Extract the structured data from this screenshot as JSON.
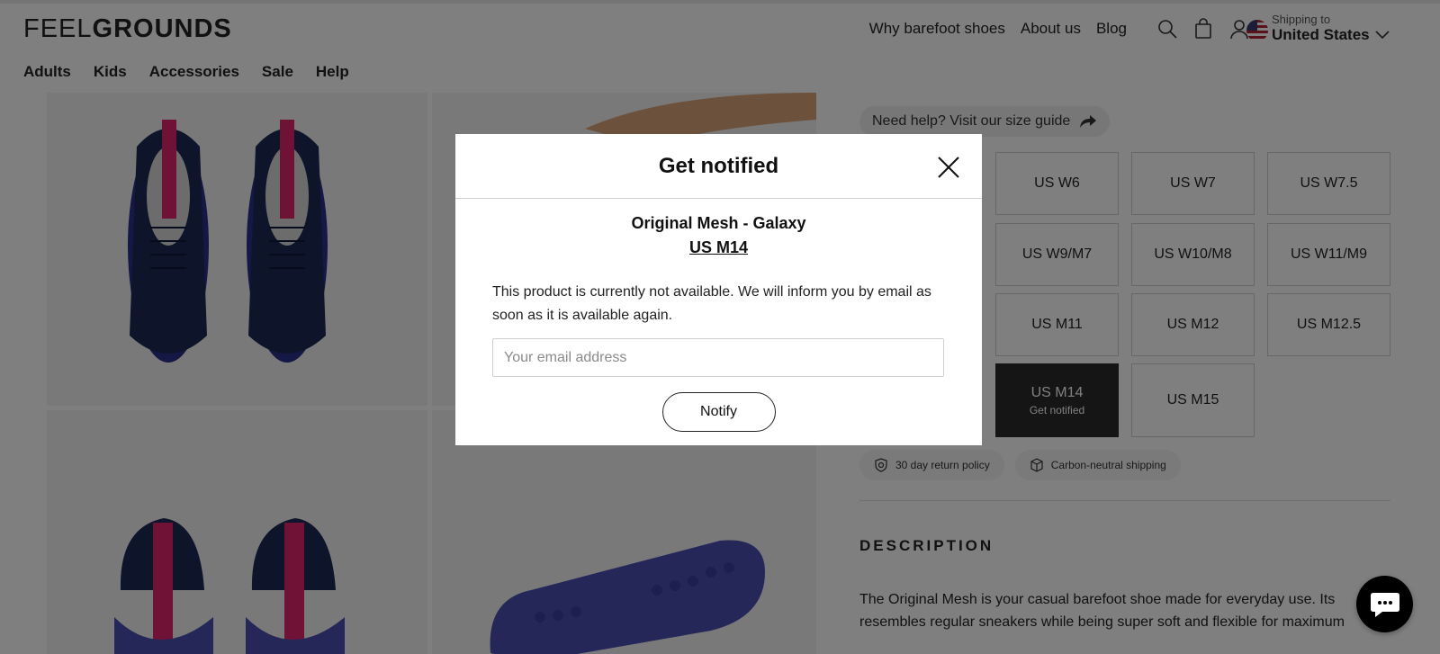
{
  "header": {
    "logo_thin": "FEEL",
    "logo_bold": "GROUNDS",
    "top_links": [
      "Why barefoot shoes",
      "About us",
      "Blog"
    ],
    "shipping_label": "Shipping to",
    "shipping_country": "United States",
    "nav": [
      "Adults",
      "Kids",
      "Accessories",
      "Sale",
      "Help"
    ]
  },
  "product": {
    "size_guide": "Need help? Visit our size guide",
    "sizes": [
      {
        "label": "US W6"
      },
      {
        "label": "US W7"
      },
      {
        "label": "US W7.5"
      },
      {
        "label": "US W9/M7"
      },
      {
        "label": "US W10/M8"
      },
      {
        "label": "US W11/M9"
      },
      {
        "label": "US M11"
      },
      {
        "label": "US M12"
      },
      {
        "label": "US M12.5"
      },
      {
        "label": "US M14",
        "sub": "Get notified"
      },
      {
        "label": "US M15"
      }
    ],
    "badges": [
      "30 day return policy",
      "Carbon-neutral shipping"
    ],
    "description_title": "DESCRIPTION",
    "description_text": "The Original Mesh is your casual barefoot shoe made for everyday use. Its resembles regular sneakers while being super soft and flexible for maximum"
  },
  "modal": {
    "title": "Get notified",
    "product_name": "Original Mesh - Galaxy",
    "size": "US M14",
    "info": "This product is currently not available. We will inform you by email as soon as it is available again.",
    "email_placeholder": "Your email address",
    "email_value": "",
    "notify_label": "Notify"
  },
  "colors": {
    "overlay": "#000000",
    "selected_size_bg": "#2b2b2b",
    "shoe_body": "#1c2a55",
    "shoe_accent": "#e0246a",
    "sole": "#4a4fb3"
  }
}
